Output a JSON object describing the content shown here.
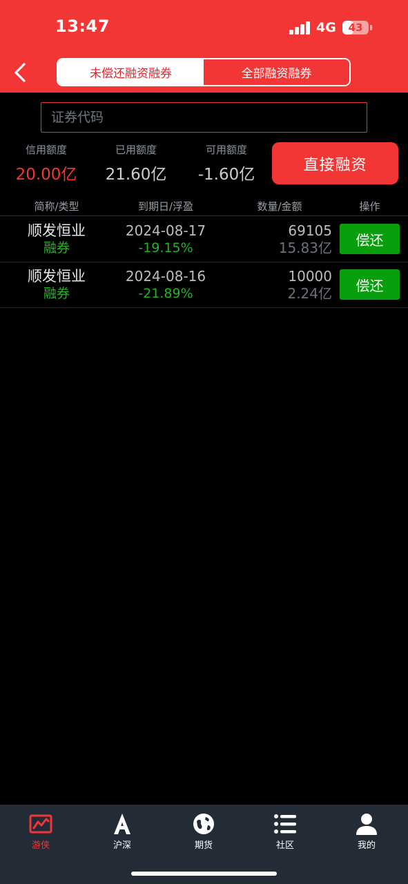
{
  "status_bar": {
    "time": "13:47",
    "network": "4G",
    "battery": "43",
    "battery_level": 0.43
  },
  "header": {
    "tabs": [
      {
        "label": "未偿还融资融券",
        "active": true
      },
      {
        "label": "全部融资融券",
        "active": false
      }
    ]
  },
  "search": {
    "placeholder": "证券代码",
    "value": ""
  },
  "stats": [
    {
      "label": "信用额度",
      "value": "20.00亿"
    },
    {
      "label": "已用额度",
      "value": "21.60亿"
    },
    {
      "label": "可用额度",
      "value": "-1.60亿"
    }
  ],
  "direct_button": "直接融资",
  "table": {
    "headers": [
      "简称/类型",
      "到期日/浮盈",
      "数量/金额",
      "操作"
    ],
    "rows": [
      {
        "name": "顺发恒业",
        "type": "融券",
        "date": "2024-08-17",
        "pnl": "-19.15%",
        "quantity": "69105",
        "amount": "15.83亿",
        "action": "偿还"
      },
      {
        "name": "顺发恒业",
        "type": "融券",
        "date": "2024-08-16",
        "pnl": "-21.89%",
        "quantity": "10000",
        "amount": "2.24亿",
        "action": "偿还"
      }
    ]
  },
  "tabbar": {
    "items": [
      {
        "label": "游侠",
        "icon": "chart-icon",
        "active": true
      },
      {
        "label": "沪深",
        "icon": "letter-a-icon",
        "active": false
      },
      {
        "label": "期货",
        "icon": "globe-icon",
        "active": false
      },
      {
        "label": "社区",
        "icon": "list-icon",
        "active": false
      },
      {
        "label": "我的",
        "icon": "user-icon",
        "active": false
      }
    ]
  },
  "colors": {
    "accent": "#f23535",
    "profit_green": "#22b422",
    "repay_green": "#099e0d",
    "tabbar_bg": "#222b36"
  }
}
